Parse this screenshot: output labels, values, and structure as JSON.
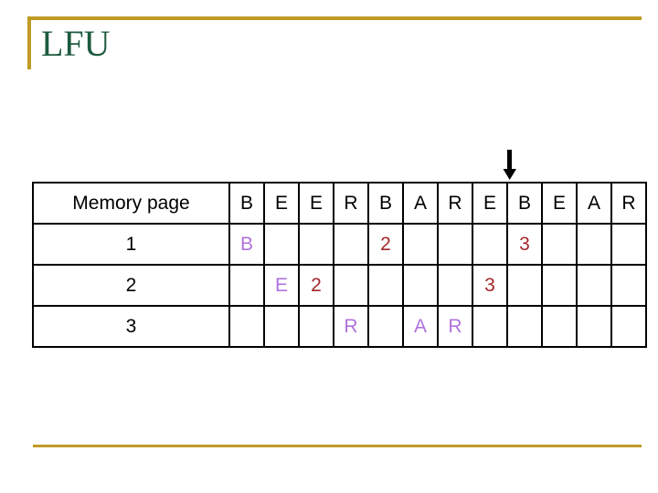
{
  "slide": {
    "title": "LFU",
    "accent_color": "#bf9b24",
    "title_color": "#1d5b40"
  },
  "pointer": {
    "icon": "arrow-down-icon",
    "points_to_column_index": 8,
    "points_to_label": "B"
  },
  "table": {
    "row_header_label": "Memory page",
    "reference_string": [
      "B",
      "E",
      "E",
      "R",
      "B",
      "A",
      "R",
      "E",
      "B",
      "E",
      "A",
      "R"
    ],
    "colors": {
      "letter": "#b072dd",
      "number": "#a4272c",
      "header": "#000000"
    },
    "rows": [
      {
        "label": "1",
        "cells": [
          {
            "text": "B",
            "kind": "letter"
          },
          {
            "text": "",
            "kind": "empty"
          },
          {
            "text": "",
            "kind": "empty"
          },
          {
            "text": "",
            "kind": "empty"
          },
          {
            "text": "2",
            "kind": "number"
          },
          {
            "text": "",
            "kind": "empty"
          },
          {
            "text": "",
            "kind": "empty"
          },
          {
            "text": "",
            "kind": "empty"
          },
          {
            "text": "3",
            "kind": "number"
          },
          {
            "text": "",
            "kind": "empty"
          },
          {
            "text": "",
            "kind": "empty"
          },
          {
            "text": "",
            "kind": "empty"
          }
        ]
      },
      {
        "label": "2",
        "cells": [
          {
            "text": "",
            "kind": "empty"
          },
          {
            "text": "E",
            "kind": "letter"
          },
          {
            "text": "2",
            "kind": "number"
          },
          {
            "text": "",
            "kind": "empty"
          },
          {
            "text": "",
            "kind": "empty"
          },
          {
            "text": "",
            "kind": "empty"
          },
          {
            "text": "",
            "kind": "empty"
          },
          {
            "text": "3",
            "kind": "number"
          },
          {
            "text": "",
            "kind": "empty"
          },
          {
            "text": "",
            "kind": "empty"
          },
          {
            "text": "",
            "kind": "empty"
          },
          {
            "text": "",
            "kind": "empty"
          }
        ]
      },
      {
        "label": "3",
        "cells": [
          {
            "text": "",
            "kind": "empty"
          },
          {
            "text": "",
            "kind": "empty"
          },
          {
            "text": "",
            "kind": "empty"
          },
          {
            "text": "R",
            "kind": "letter"
          },
          {
            "text": "",
            "kind": "empty"
          },
          {
            "text": "A",
            "kind": "letter"
          },
          {
            "text": "R",
            "kind": "letter"
          },
          {
            "text": "",
            "kind": "empty"
          },
          {
            "text": "",
            "kind": "empty"
          },
          {
            "text": "",
            "kind": "empty"
          },
          {
            "text": "",
            "kind": "empty"
          },
          {
            "text": "",
            "kind": "empty"
          }
        ]
      }
    ]
  }
}
